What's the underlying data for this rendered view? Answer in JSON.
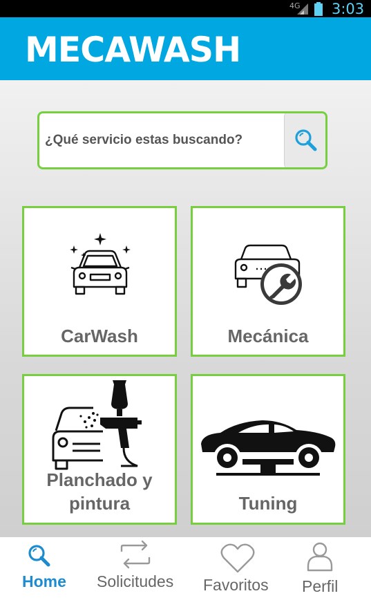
{
  "status_bar": {
    "network": "4G",
    "time": "3:03"
  },
  "app": {
    "title": "MECAWASH"
  },
  "search": {
    "placeholder": "¿Qué servicio estas buscando?"
  },
  "categories": [
    {
      "label": "CarWash",
      "icon": "car-wash-icon"
    },
    {
      "label": "Mecánica",
      "icon": "car-wrench-icon"
    },
    {
      "label_line1": "Planchado y",
      "label_line2": "pintura",
      "icon": "spray-gun-icon"
    },
    {
      "label": "Tuning",
      "icon": "car-lift-icon"
    }
  ],
  "nav": [
    {
      "label": "Home",
      "icon": "search-icon",
      "active": true
    },
    {
      "label": "Solicitudes",
      "icon": "swap-arrows-icon"
    },
    {
      "label": "Favoritos",
      "icon": "heart-icon"
    },
    {
      "label": "Perfil",
      "icon": "user-icon"
    }
  ],
  "colors": {
    "primary": "#01a7e1",
    "accent_green": "#77cf3f",
    "nav_active": "#1c8bd0"
  }
}
